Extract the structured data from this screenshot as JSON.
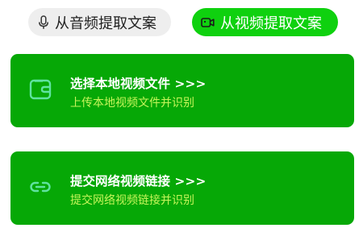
{
  "tabs": {
    "audio": {
      "label": "从音频提取文案",
      "icon": "microphone-icon"
    },
    "video": {
      "label": "从视频提取文案",
      "icon": "video-camera-icon",
      "active": true
    }
  },
  "cards": {
    "upload": {
      "title": "选择本地视频文件 >>>",
      "subtitle": "上传本地视频文件并识别",
      "icon": "wallet-icon"
    },
    "link": {
      "title": "提交网络视频链接 >>>",
      "subtitle": "提交网络视频链接并识别",
      "icon": "link-icon"
    }
  },
  "colors": {
    "active_tab": "#0fd10f",
    "inactive_tab": "#eeeeee",
    "card_bg": "#06a806",
    "subtitle": "#c6f55a",
    "icon_stroke": "#5fe3a0"
  }
}
